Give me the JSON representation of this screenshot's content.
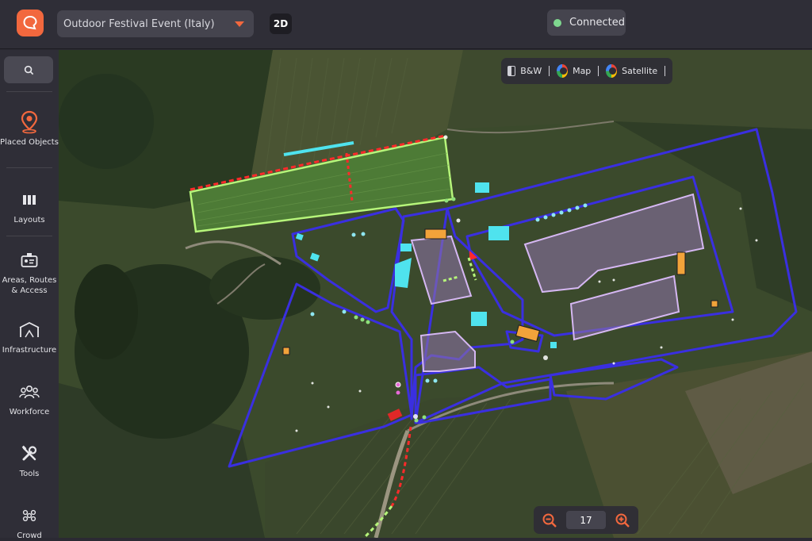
{
  "app": {
    "logo_icon": "logo-icon",
    "brand_color": "#f2683e"
  },
  "header": {
    "event_select": {
      "value": "Outdoor Festival Event (Italy)",
      "icon": "chevron-down-icon"
    },
    "view_mode": "2D",
    "connection": {
      "label": "Connected",
      "color": "#7fd88f"
    }
  },
  "sidebar": {
    "search_icon": "search-icon",
    "items": [
      {
        "label": "Placed Objects",
        "icon": "map-pin-icon",
        "active": true
      },
      {
        "label": "Layouts",
        "icon": "columns-icon"
      },
      {
        "label": "Areas, Routes & Access",
        "icon": "badge-icon"
      },
      {
        "label": "Infrastructure",
        "icon": "tent-icon"
      },
      {
        "label": "Workforce",
        "icon": "people-icon"
      },
      {
        "label": "Tools",
        "icon": "tools-icon"
      },
      {
        "label": "Crowd",
        "icon": "crowd-icon"
      }
    ]
  },
  "map": {
    "layers": [
      {
        "label": "B&W",
        "icon": "bw-icon"
      },
      {
        "label": "Map",
        "icon": "google-icon"
      },
      {
        "label": "Satellite",
        "icon": "google-icon"
      }
    ],
    "zoom": {
      "level": "17",
      "zoom_out_icon": "zoom-out-icon",
      "zoom_in_icon": "zoom-in-icon"
    },
    "colors": {
      "boundary": "#3a2fe0",
      "field": "#b6f57a",
      "building": "#b9a0d6",
      "route": "#ff2a2a",
      "cyan": "#4fe3ee",
      "orange": "#f2a33a"
    }
  }
}
